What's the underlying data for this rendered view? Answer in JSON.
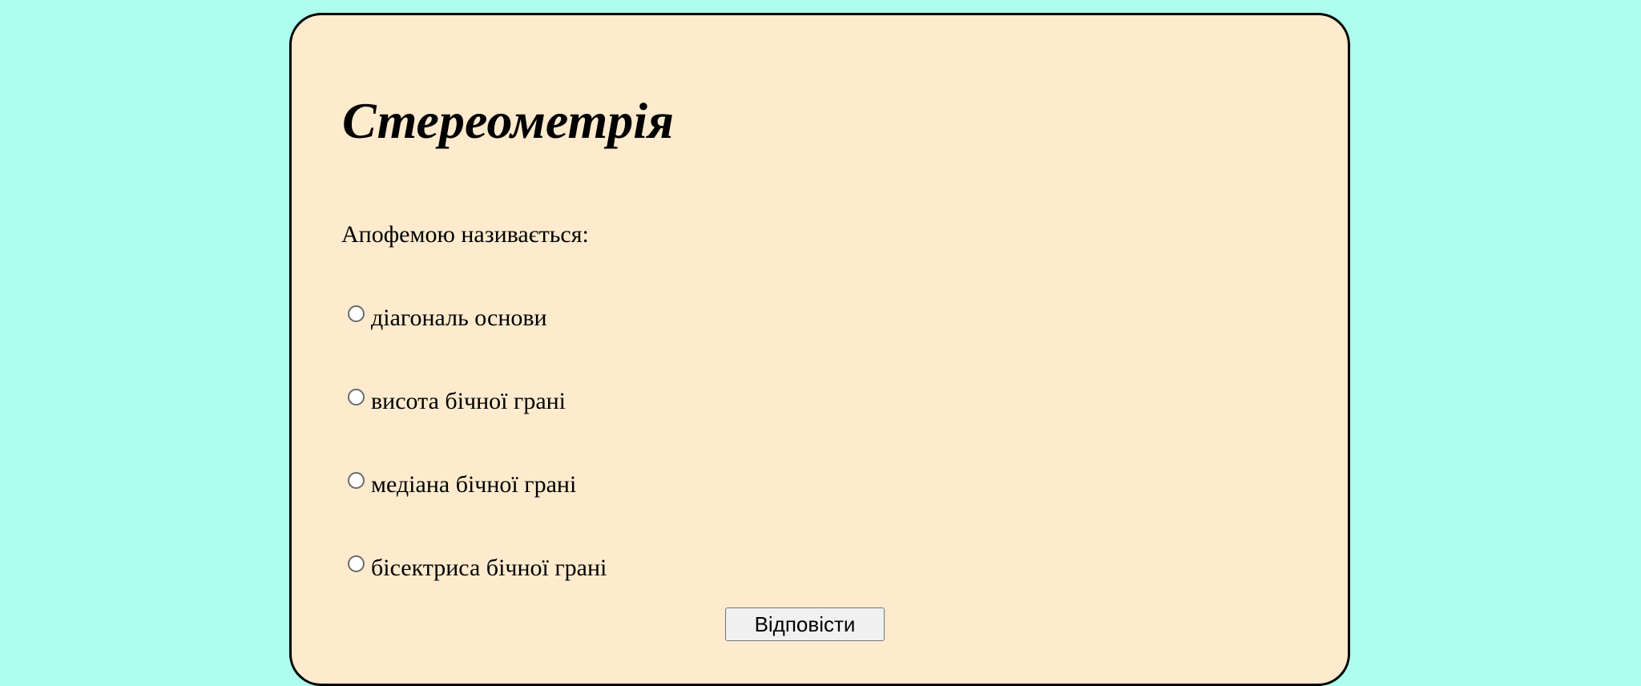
{
  "quiz": {
    "title": "Стереометрія",
    "question": "Апофемою називається:",
    "options": [
      {
        "label": "діагональ основи",
        "selected": false
      },
      {
        "label": "висота бічної грані",
        "selected": false
      },
      {
        "label": "медіана бічної грані",
        "selected": false
      },
      {
        "label": "бісектриса бічної грані",
        "selected": false
      }
    ],
    "submit_label": "Відповісти"
  },
  "colors": {
    "page_background": "#adfeec",
    "card_background": "#feebce",
    "card_border": "#000000"
  }
}
